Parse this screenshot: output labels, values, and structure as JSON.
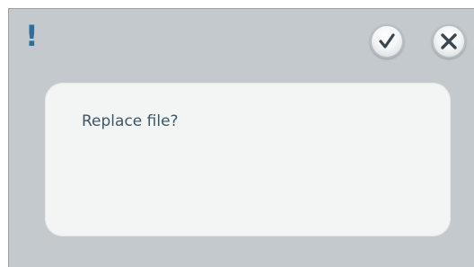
{
  "dialog": {
    "alert_symbol": "!",
    "alert_icon": "exclamation-icon",
    "confirm_icon": "checkmark-icon",
    "close_icon": "close-x-icon",
    "message": "Replace file?",
    "colors": {
      "frame": "#c3c9cd",
      "panel": "#f3f4f4",
      "accent": "#2c6f9a",
      "text": "#3f5666",
      "icon_stroke": "#3a4750"
    }
  }
}
